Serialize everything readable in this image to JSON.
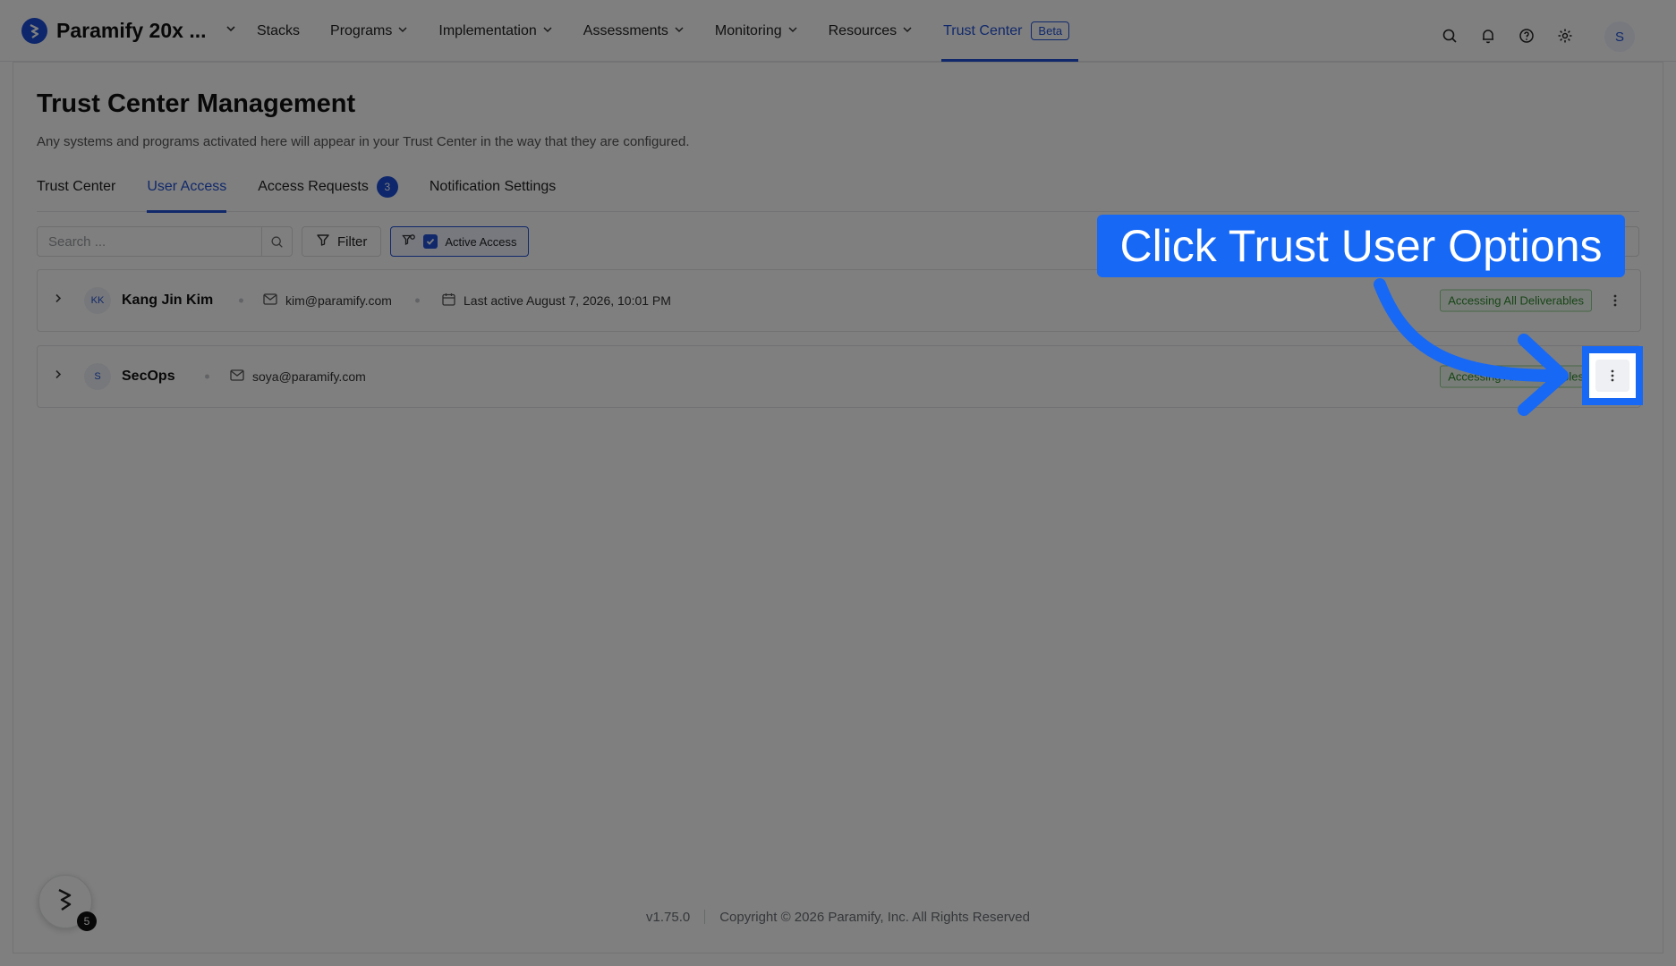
{
  "app": {
    "name": "Paramify 20x ...",
    "nav": [
      {
        "label": "Stacks",
        "has_menu": false
      },
      {
        "label": "Programs",
        "has_menu": true
      },
      {
        "label": "Implementation",
        "has_menu": true
      },
      {
        "label": "Assessments",
        "has_menu": true
      },
      {
        "label": "Monitoring",
        "has_menu": true
      },
      {
        "label": "Resources",
        "has_menu": true
      },
      {
        "label": "Trust Center",
        "has_menu": false,
        "active": true,
        "badge": "Beta"
      }
    ],
    "user_initial": "S"
  },
  "page": {
    "title": "Trust Center Management",
    "subtitle": "Any systems and programs activated here will appear in your Trust Center in the way that they are configured.",
    "tabs": [
      {
        "label": "Trust Center"
      },
      {
        "label": "User Access",
        "active": true
      },
      {
        "label": "Access Requests",
        "count": "3"
      },
      {
        "label": "Notification Settings"
      }
    ]
  },
  "toolbar": {
    "search_placeholder": "Search ...",
    "filter_label": "Filter",
    "active_access_label": "Active Access",
    "active_access_checked": true
  },
  "users": [
    {
      "initials": "KK",
      "name": "Kang Jin Kim",
      "email": "kim@paramify.com",
      "last_active": "Last active August 7, 2026, 10:01 PM",
      "status": "Accessing All Deliverables"
    },
    {
      "initials": "S",
      "name": "SecOps",
      "email": "soya@paramify.com",
      "status": "Accessing All Deliverables"
    }
  ],
  "footer": {
    "version": "v1.75.0",
    "copyright": "Copyright © 2026 Paramify, Inc. All Rights Reserved"
  },
  "widget": {
    "badge": "5"
  },
  "tutorial": {
    "callout": "Click Trust User Options",
    "accent": "#1768f5"
  }
}
